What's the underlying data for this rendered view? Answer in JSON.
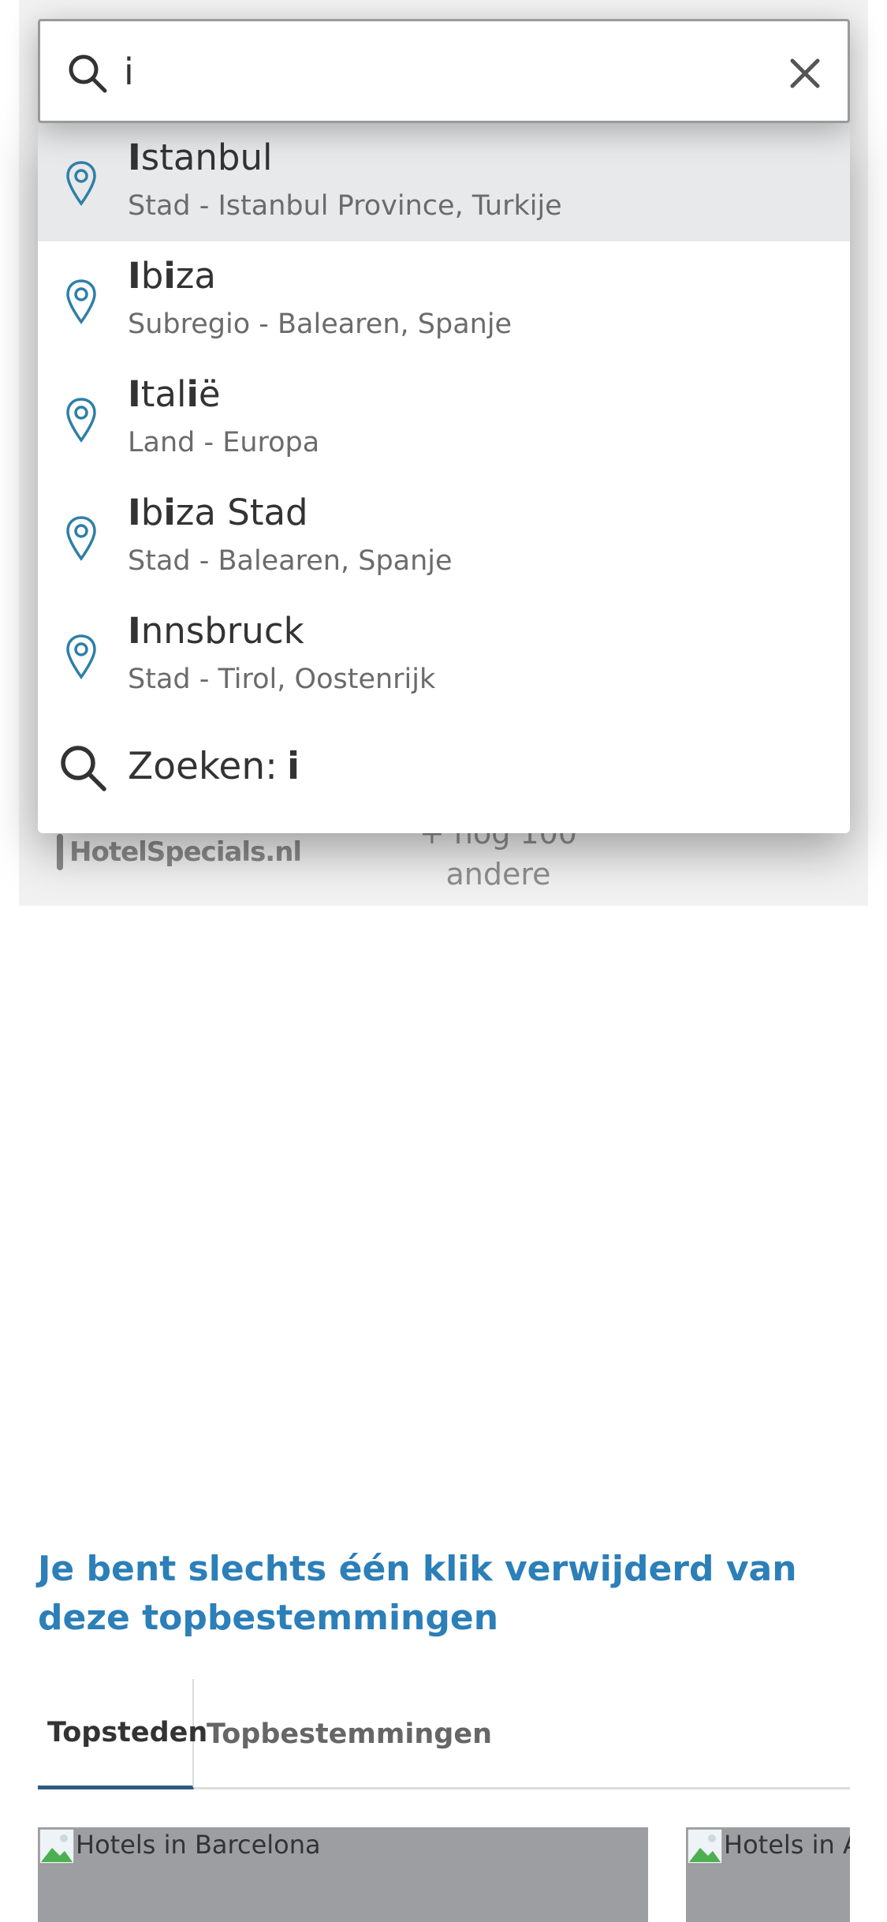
{
  "search": {
    "value": "i",
    "placeholder": ""
  },
  "suggestions": [
    {
      "match": "I",
      "rest": "stanbul",
      "detail": "Stad - Istanbul Province, Turkije"
    },
    {
      "match": "I",
      "mid": "b",
      "match2": "i",
      "rest": "za",
      "detail": "Subregio - Balearen, Spanje"
    },
    {
      "match": "I",
      "mid": "tal",
      "match2": "i",
      "rest": "ë",
      "detail": "Land - Europa"
    },
    {
      "match": "I",
      "mid": "b",
      "match2": "i",
      "rest": "za Stad",
      "detail": "Stad - Balearen, Spanje"
    },
    {
      "match": "I",
      "rest": "nnsbruck",
      "detail": "Stad - Tirol, Oostenrijk"
    }
  ],
  "search_all": {
    "label": "Zoeken:",
    "term": "i"
  },
  "partners": {
    "logo_text": "HotelSpecials.nl",
    "more_line1": "+ nog 100",
    "more_line2": "andere"
  },
  "destinations": {
    "heading": "Je bent slechts één klik verwijderd van deze topbestemmingen",
    "tabs": [
      "Topsteden",
      "Topbestemmingen"
    ],
    "cards": [
      "Hotels in Barcelona",
      "Hotels in A"
    ]
  },
  "colors": {
    "accent": "#2c7fb8",
    "pin": "#2d7fa8",
    "active_row": "#e8e9ea"
  }
}
